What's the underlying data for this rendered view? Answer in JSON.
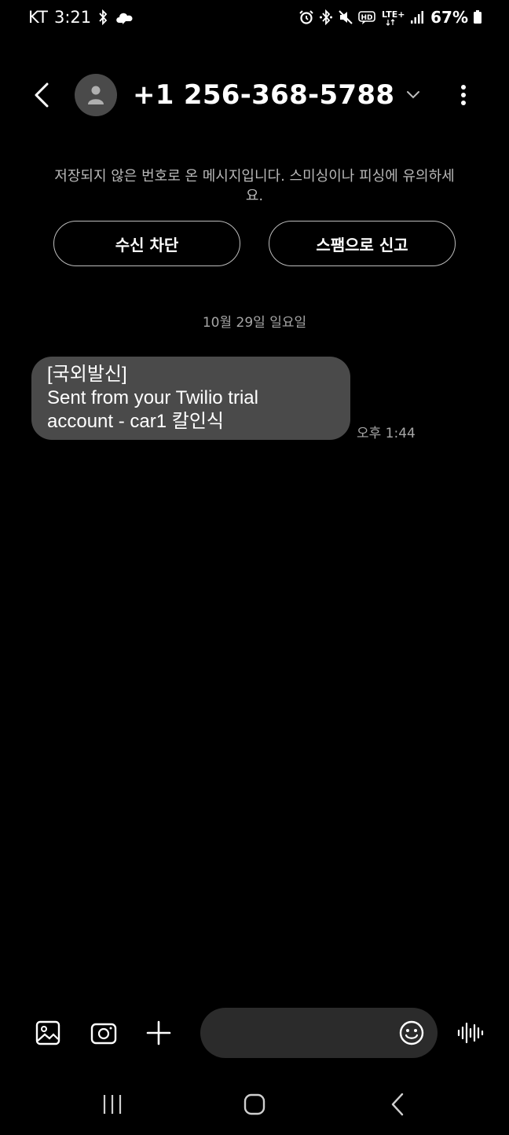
{
  "status_bar": {
    "carrier": "KT",
    "time": "3:21",
    "network": "LTE+",
    "battery": "67%"
  },
  "header": {
    "contact": "+1 256-368-5788"
  },
  "warning": {
    "text": "저장되지 않은 번호로 온 메시지입니다. 스미싱이나 피싱에 유의하세요.",
    "block_label": "수신 차단",
    "spam_label": "스팸으로 신고"
  },
  "conversation": {
    "date": "10월 29일 일요일",
    "messages": [
      {
        "lines": [
          "[국외발신]",
          "Sent from your Twilio trial",
          "account - car1 칼인식"
        ],
        "time": "오후 1:44"
      }
    ]
  },
  "composer": {
    "placeholder": ""
  },
  "icons": {
    "status_left": [
      "bluetooth-icon",
      "cloud-icon"
    ],
    "status_right": [
      "alarm-icon",
      "bluetooth-icon",
      "mute-icon",
      "hd-voice-icon",
      "lte-icon",
      "signal-icon",
      "battery-icon"
    ],
    "composer": [
      "gallery-icon",
      "camera-icon",
      "plus-icon",
      "emoji-icon",
      "voice-icon"
    ],
    "nav": [
      "recents-icon",
      "home-icon",
      "back-icon"
    ]
  },
  "colors": {
    "background": "#000000",
    "bubble": "#4a4a4a",
    "input": "#2b2b2b",
    "secondary_text": "#a6a6a6"
  }
}
